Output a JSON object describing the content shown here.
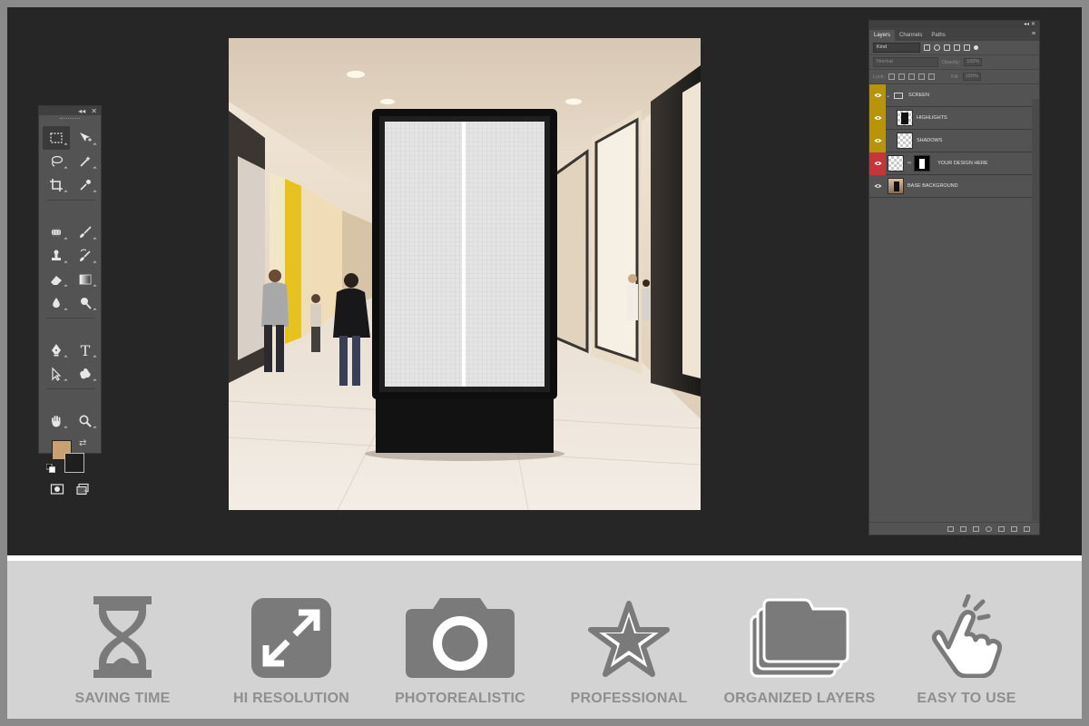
{
  "colors": {
    "outer_bg": "#8a8a8a",
    "workspace_bg": "#262626",
    "panel_bg": "#535353",
    "feature_bg": "#d3d3d3",
    "feature_icon": "#7a7a7a",
    "foreground_swatch": "#c9a071",
    "background_swatch": "#1e1e1e",
    "eye_yellow": "#b8940a",
    "eye_red": "#c4363a"
  },
  "toolbox": {
    "collapse_glyph": "◂◂",
    "close_glyph": "✕",
    "tools": [
      {
        "name": "rectangular-marquee-tool-icon",
        "active": true
      },
      {
        "name": "move-tool-icon"
      },
      {
        "name": "lasso-tool-icon"
      },
      {
        "name": "magic-wand-tool-icon"
      },
      {
        "name": "crop-tool-icon"
      },
      {
        "name": "eyedropper-tool-icon"
      },
      {
        "name": "spot-healing-tool-icon"
      },
      {
        "name": "brush-tool-icon"
      },
      {
        "name": "clone-stamp-tool-icon"
      },
      {
        "name": "history-brush-tool-icon"
      },
      {
        "name": "eraser-tool-icon"
      },
      {
        "name": "gradient-tool-icon"
      },
      {
        "name": "blur-tool-icon"
      },
      {
        "name": "dodge-tool-icon"
      },
      {
        "name": "pen-tool-icon"
      },
      {
        "name": "type-tool-icon"
      },
      {
        "name": "path-selection-tool-icon"
      },
      {
        "name": "custom-shape-tool-icon"
      },
      {
        "name": "hand-tool-icon"
      },
      {
        "name": "zoom-tool-icon"
      }
    ],
    "type_glyph": "T",
    "swap_glyph": "⇄"
  },
  "layers_panel": {
    "collapse_glyph": "◂◂",
    "close_glyph": "✕",
    "tabs": [
      "Layers",
      "Channels",
      "Paths"
    ],
    "menu_glyph": "≡",
    "filter_kind": "Kind",
    "blend_mode": "Normal",
    "opacity_label": "Opacity:",
    "opacity_value": "100%",
    "lock_label": "Lock:",
    "fill_label": "Fill:",
    "fill_value": "100%",
    "layers": [
      {
        "name": "SCREEN",
        "type": "group",
        "eye": "yellow"
      },
      {
        "name": "HIGHLIGHTS",
        "type": "layer",
        "eye": "yellow"
      },
      {
        "name": "SHADOWS",
        "type": "layer",
        "eye": "yellow"
      },
      {
        "name": "YOUR DESIGN HERE",
        "type": "smart-object",
        "eye": "red"
      },
      {
        "name": "BASE BACKGROUND",
        "type": "photo",
        "eye": "none"
      }
    ]
  },
  "features": [
    {
      "label": "SAVING TIME",
      "icon": "hourglass-icon"
    },
    {
      "label": "HI RESOLUTION",
      "icon": "expand-arrows-icon"
    },
    {
      "label": "PHOTOREALISTIC",
      "icon": "camera-icon"
    },
    {
      "label": "PROFESSIONAL",
      "icon": "star-icon"
    },
    {
      "label": "ORGANIZED LAYERS",
      "icon": "stacked-folders-icon"
    },
    {
      "label": "EASY TO USE",
      "icon": "tap-hand-icon"
    }
  ]
}
